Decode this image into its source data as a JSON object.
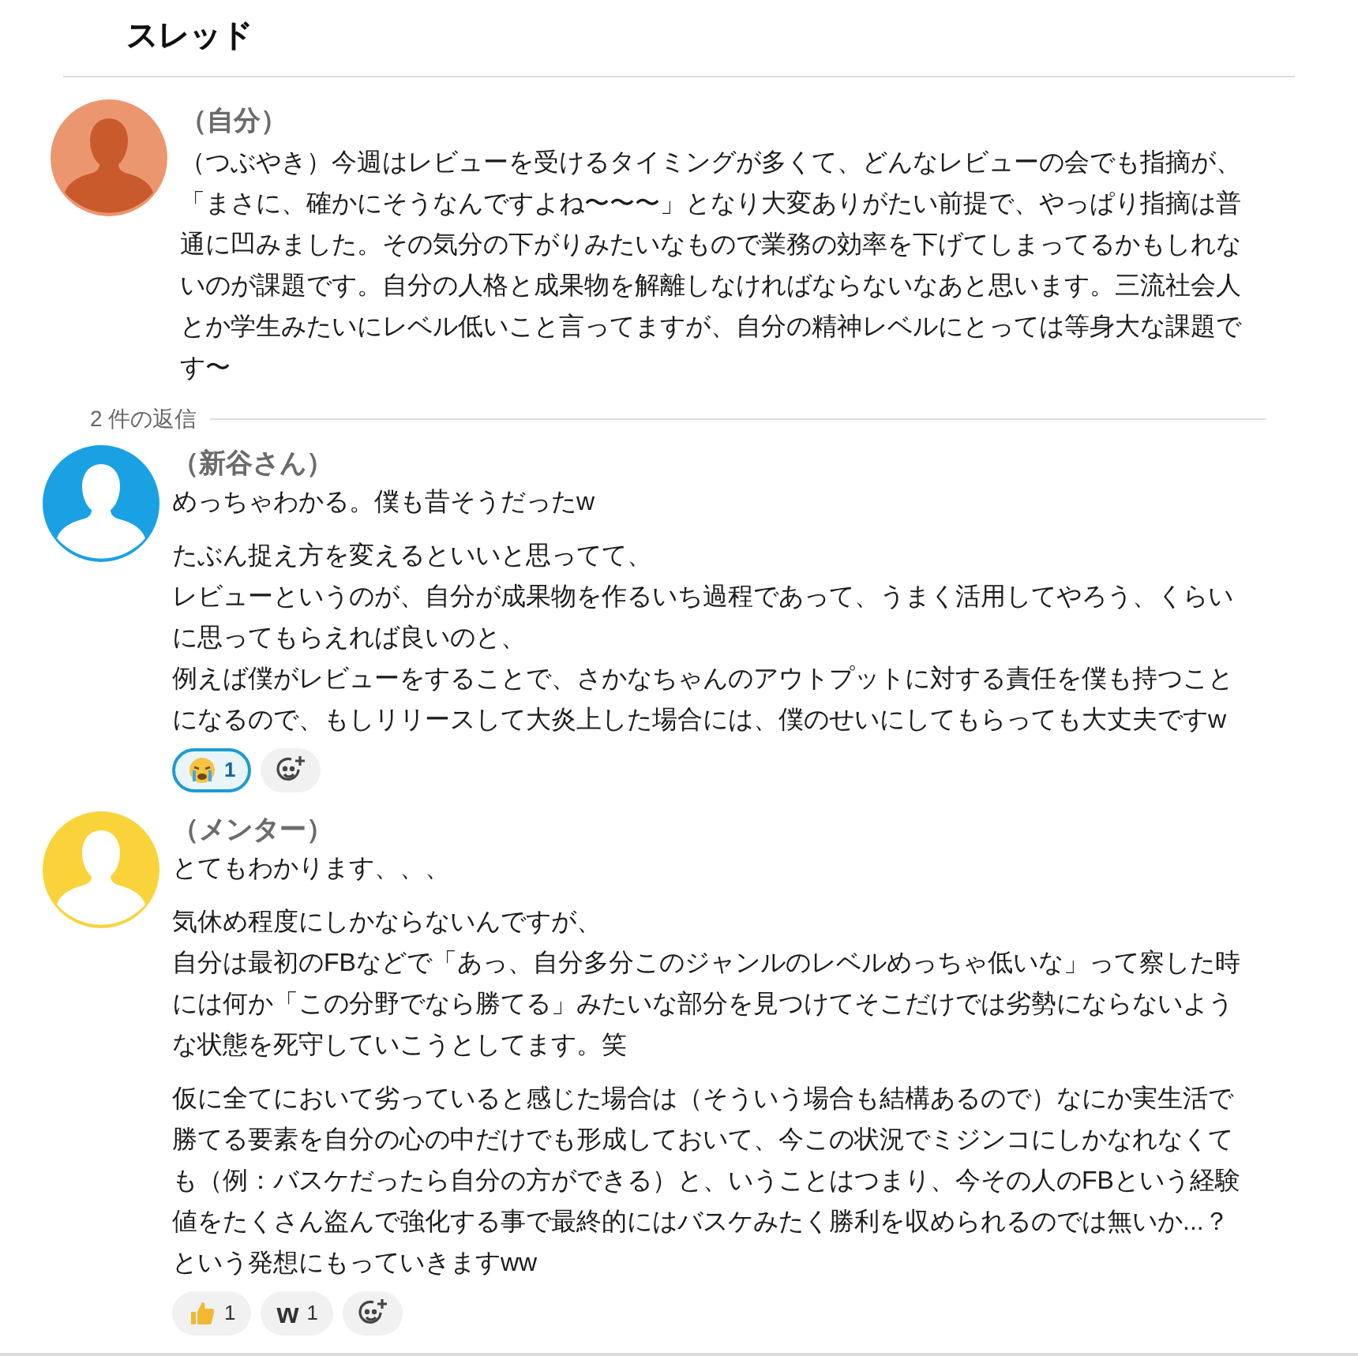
{
  "title": "スレッド",
  "root": {
    "author": "（自分）",
    "avatar": {
      "color": "#ec9670",
      "kind": "shaded"
    },
    "paragraphs": [
      [
        "（つぶやき）今週はレビューを受けるタイミングが多くて、どんなレビューの会でも指摘が、「まさに、確かにそうなんですよね〜〜〜」となり大変ありがたい前提で、やっぱり指摘は普通に凹みました。その気分の下がりみたいなもので業務の効率を下げてしまってるかもしれないのが課題です。自分の人格と成果物を解離しなければならないなあと思います。三流社会人とか学生みたいにレベル低いこと言ってますが、自分の精神レベルにとっては等身大な課題です〜"
      ]
    ]
  },
  "replies_label": "2 件の返信",
  "replies": [
    {
      "author": "（新谷さん）",
      "avatar": {
        "color": "#1aa1e3",
        "kind": "plain"
      },
      "paragraphs": [
        [
          "めっちゃわかる。僕も昔そうだったw"
        ],
        [
          "たぶん捉え方を変えるといいと思ってて、",
          "レビューというのが、自分が成果物を作るいち過程であって、うまく活用してやろう、くらいに思ってもらえれば良いのと、",
          "例えば僕がレビューをすることで、さかなちゃんのアウトプットに対する責任を僕も持つことになるので、もしリリースして大炎上した場合には、僕のせいにしてもらっても大丈夫ですw"
        ]
      ],
      "reactions": [
        {
          "kind": "crying",
          "count": "1",
          "selected": true
        }
      ]
    },
    {
      "author": "（メンター）",
      "avatar": {
        "color": "#fad33b",
        "kind": "plain"
      },
      "paragraphs": [
        [
          "とてもわかります、、、"
        ],
        [
          "気休め程度にしかならないんですが、",
          "自分は最初のFBなどで「あっ、自分多分このジャンルのレベルめっちゃ低いな」って察した時には何か「この分野でなら勝てる」みたいな部分を見つけてそこだけでは劣勢にならないような状態を死守していこうとしてます。笑"
        ],
        [
          "仮に全てにおいて劣っていると感じた場合は（そういう場合も結構あるので）なにか実生活で勝てる要素を自分の心の中だけでも形成しておいて、今この状況でミジンコにしかなれなくても（例：バスケだったら自分の方ができる）と、いうことはつまり、今その人のFBという経験値をたくさん盗んで強化する事で最終的にはバスケみたく勝利を収められるのでは無いか...？という発想にもっていきますww"
        ]
      ],
      "reactions": [
        {
          "kind": "thumbs-up",
          "count": "1",
          "selected": false
        },
        {
          "kind": "text",
          "symbol": "w",
          "count": "1",
          "selected": false
        }
      ]
    }
  ]
}
